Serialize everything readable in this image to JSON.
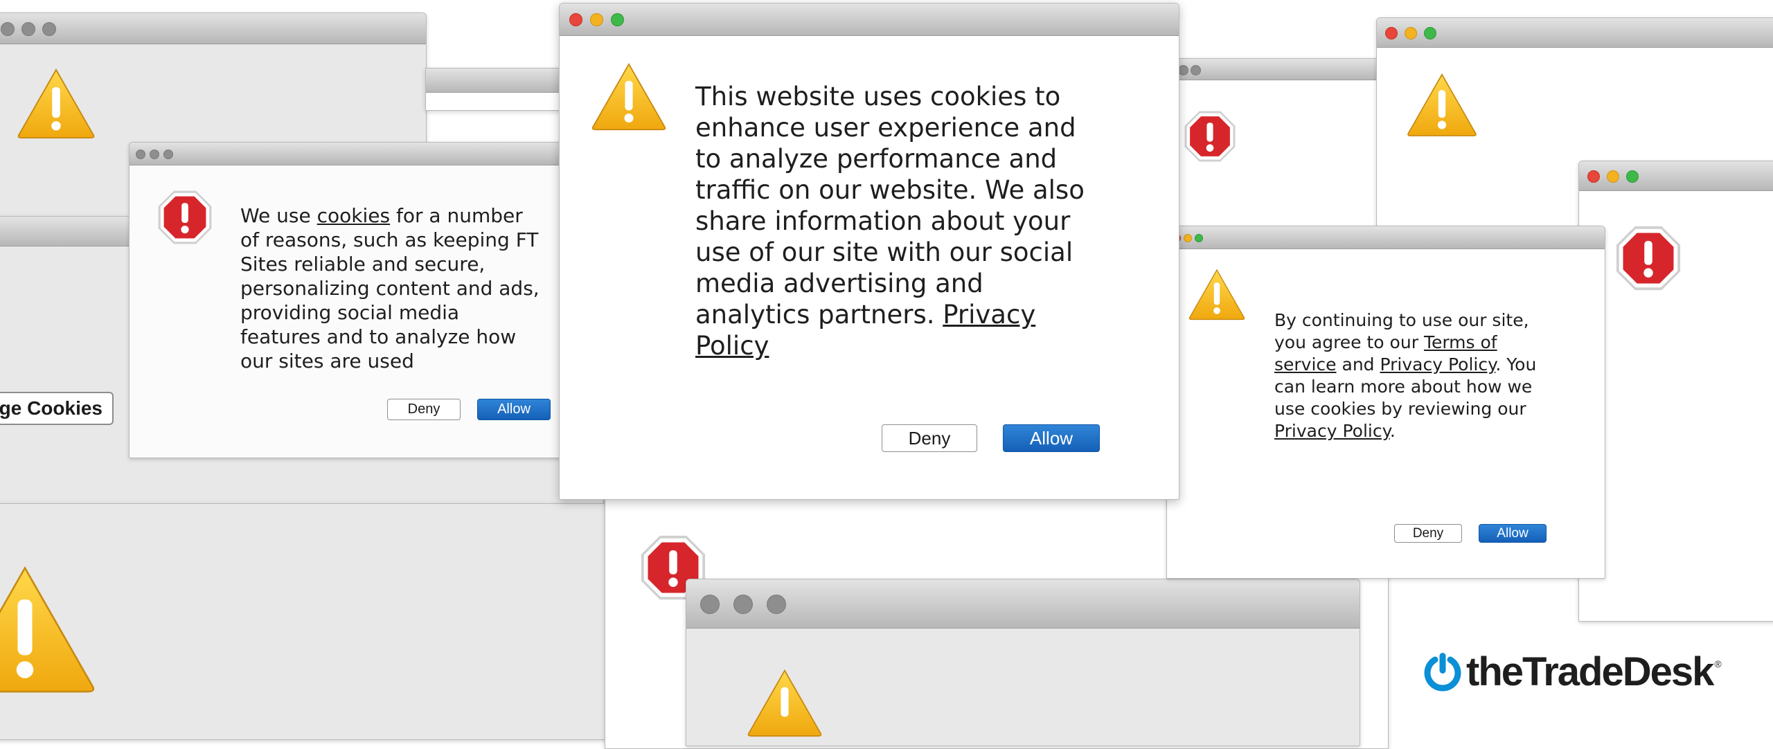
{
  "dialog_main": {
    "message": "This website uses cookies to enhance user experience and to analyze performance and traffic on our website. We also share information about your use of our site with our social media advertising and analytics partners.",
    "link": "Privacy Policy",
    "deny_label": "Deny",
    "allow_label": "Allow"
  },
  "dialog_ft": {
    "prefix": "We use",
    "link": "cookies",
    "message": "for a number of reasons, such as keeping FT Sites reliable and secure, personalizing content and ads, providing social media features and to analyze how our sites are used",
    "deny_label": "Deny",
    "allow_label": "Allow"
  },
  "dialog_terms": {
    "text1": "By continuing to use our site, you agree to our",
    "link1": "Terms of service",
    "text2": "and",
    "link2": "Privacy Policy",
    "text3": ". You can learn more about how we use cookies by reviewing our",
    "link3": "Privacy Policy",
    "text4": ".",
    "deny_label": "Deny",
    "allow_label": "Allow"
  },
  "manage_cookies_label": "Manage Cookies",
  "brand": {
    "name": "theTradeDesk",
    "trademark": "®"
  },
  "colors": {
    "allow_button": "#1a6cc6",
    "warning_yellow": "#f7c51a",
    "stop_red": "#d7262b",
    "brand_blue": "#0b8fd6"
  },
  "icons": [
    "warning-icon",
    "stop-icon",
    "power-icon"
  ]
}
